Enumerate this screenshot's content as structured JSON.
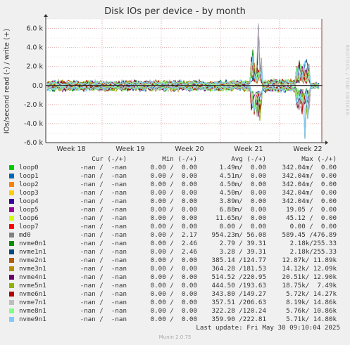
{
  "chart_data": {
    "type": "line",
    "title": "Disk IOs per device - by month",
    "ylabel": "IOs/second read (-) / write (+)",
    "ylim": [
      -6000,
      7000
    ],
    "y_ticks": [
      "6.0 k",
      "4.0 k",
      "2.0 k",
      "0.0",
      "-2.0 k",
      "-4.0 k",
      "-6.0 k"
    ],
    "y_tick_values": [
      6000,
      4000,
      2000,
      0,
      -2000,
      -4000,
      -6000
    ],
    "x_ticks": [
      "Week 18",
      "Week 19",
      "Week 20",
      "Week 21",
      "Week 22"
    ],
    "grid": true,
    "series": [
      {
        "name": "loop0",
        "color": "#00cc00"
      },
      {
        "name": "loop1",
        "color": "#0066b3"
      },
      {
        "name": "loop2",
        "color": "#ff8000"
      },
      {
        "name": "loop3",
        "color": "#ffcc00"
      },
      {
        "name": "loop4",
        "color": "#330099"
      },
      {
        "name": "loop5",
        "color": "#990099"
      },
      {
        "name": "loop6",
        "color": "#ccff00"
      },
      {
        "name": "loop7",
        "color": "#ff0000"
      },
      {
        "name": "md0",
        "color": "#808080"
      },
      {
        "name": "nvme0n1",
        "color": "#008f00"
      },
      {
        "name": "nvme1n1",
        "color": "#00487d"
      },
      {
        "name": "nvme2n1",
        "color": "#b35a00"
      },
      {
        "name": "nvme3n1",
        "color": "#b38f00"
      },
      {
        "name": "nvme4n1",
        "color": "#6b006b"
      },
      {
        "name": "nvme5n1",
        "color": "#8fb300"
      },
      {
        "name": "nvme6n1",
        "color": "#b30000"
      },
      {
        "name": "nvme7n1",
        "color": "#bebebe"
      },
      {
        "name": "nvme8n1",
        "color": "#80ff80"
      },
      {
        "name": "nvme9n1",
        "color": "#80c9ff"
      }
    ]
  },
  "legend": {
    "headers": {
      "cur": "Cur (-/+)",
      "min": "Min (-/+)",
      "avg": "Avg (-/+)",
      "max": "Max (-/+)"
    },
    "rows": [
      {
        "name": "loop0",
        "cur": "-nan /  -nan",
        "min": "0.00 /  0.00",
        "avg": "1.49m/  0.00",
        "max": "342.04m/  0.00"
      },
      {
        "name": "loop1",
        "cur": "-nan /  -nan",
        "min": "0.00 /  0.00",
        "avg": "4.51m/  0.00",
        "max": "342.04m/  0.00"
      },
      {
        "name": "loop2",
        "cur": "-nan /  -nan",
        "min": "0.00 /  0.00",
        "avg": "4.50m/  0.00",
        "max": "342.04m/  0.00"
      },
      {
        "name": "loop3",
        "cur": "-nan /  -nan",
        "min": "0.00 /  0.00",
        "avg": "4.50m/  0.00",
        "max": "342.04m/  0.00"
      },
      {
        "name": "loop4",
        "cur": "-nan /  -nan",
        "min": "0.00 /  0.00",
        "avg": "3.89m/  0.00",
        "max": "342.04m/  0.00"
      },
      {
        "name": "loop5",
        "cur": "-nan /  -nan",
        "min": "0.00 /  0.00",
        "avg": "6.88m/  0.00",
        "max": "19.05 /  0.00"
      },
      {
        "name": "loop6",
        "cur": "-nan /  -nan",
        "min": "0.00 /  0.00",
        "avg": "11.65m/  0.00",
        "max": "45.12 /  0.00"
      },
      {
        "name": "loop7",
        "cur": "-nan /  -nan",
        "min": "0.00 /  0.00",
        "avg": "0.00 /  0.00",
        "max": "0.00 /  0.00"
      },
      {
        "name": "md0",
        "cur": "-nan /  -nan",
        "min": "0.00 /  2.17",
        "avg": "954.23m/ 56.08",
        "max": "589.45 /476.89"
      },
      {
        "name": "nvme0n1",
        "cur": "-nan /  -nan",
        "min": "0.00 /  2.46",
        "avg": "2.79 / 39.31",
        "max": "2.18k/255.33"
      },
      {
        "name": "nvme1n1",
        "cur": "-nan /  -nan",
        "min": "0.00 /  2.46",
        "avg": "3.28 / 39.31",
        "max": "2.18k/255.33"
      },
      {
        "name": "nvme2n1",
        "cur": "-nan /  -nan",
        "min": "0.00 /  0.00",
        "avg": "385.14 /124.77",
        "max": "12.87k/ 11.89k"
      },
      {
        "name": "nvme3n1",
        "cur": "-nan /  -nan",
        "min": "0.00 /  0.00",
        "avg": "364.28 /181.53",
        "max": "14.12k/ 12.09k"
      },
      {
        "name": "nvme4n1",
        "cur": "-nan /  -nan",
        "min": "0.00 /  0.00",
        "avg": "514.52 /220.95",
        "max": "20.51k/ 12.90k"
      },
      {
        "name": "nvme5n1",
        "cur": "-nan /  -nan",
        "min": "0.00 /  0.00",
        "avg": "444.50 /193.63",
        "max": "18.75k/  7.49k"
      },
      {
        "name": "nvme6n1",
        "cur": "-nan /  -nan",
        "min": "0.00 /  0.00",
        "avg": "343.80 /149.27",
        "max": "5.72k/ 14.27k"
      },
      {
        "name": "nvme7n1",
        "cur": "-nan /  -nan",
        "min": "0.00 /  0.00",
        "avg": "357.51 /206.63",
        "max": "8.19k/ 14.86k"
      },
      {
        "name": "nvme8n1",
        "cur": "-nan /  -nan",
        "min": "0.00 /  0.00",
        "avg": "322.28 /120.24",
        "max": "5.76k/ 10.86k"
      },
      {
        "name": "nvme9n1",
        "cur": "-nan /  -nan",
        "min": "0.00 /  0.00",
        "avg": "359.90 /222.81",
        "max": "5.71k/ 14.80k"
      }
    ]
  },
  "watermark": "RRDTOOL / TOBI OETIKER",
  "last_update": "Last update: Fri May 30 09:10:04 2025",
  "generator": "Munin 2.0.75"
}
